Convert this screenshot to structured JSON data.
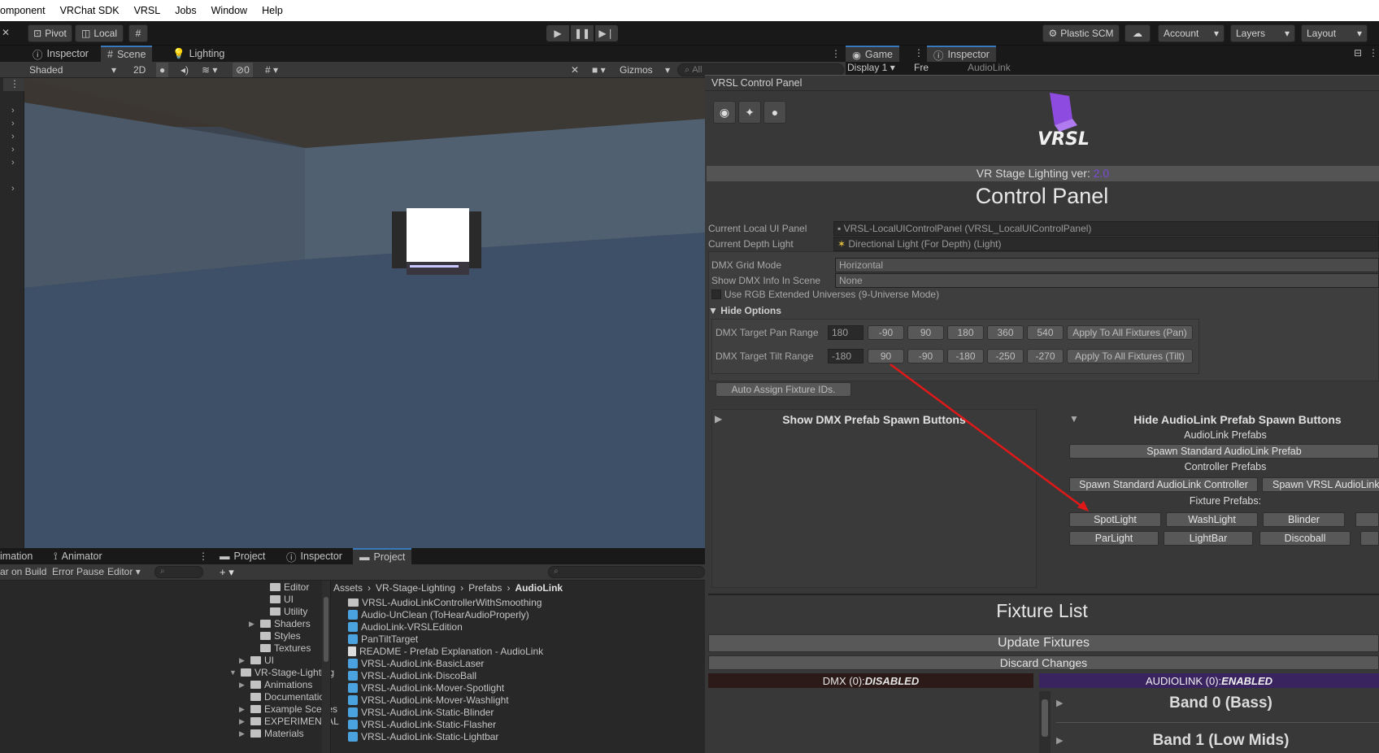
{
  "menubar": {
    "items": [
      "omponent",
      "VRChat SDK",
      "VRSL",
      "Jobs",
      "Window",
      "Help"
    ]
  },
  "toolbar": {
    "pivot": "Pivot",
    "local": "Local",
    "plastic": "Plastic SCM",
    "account": "Account",
    "layers": "Layers",
    "layout": "Layout"
  },
  "scene_tabs": {
    "inspector": "Inspector",
    "scene": "Scene",
    "lighting": "Lighting"
  },
  "scene_toolbar": {
    "shading": "Shaded",
    "mode2d": "2D",
    "hidden_count": "0",
    "gizmos": "Gizmos",
    "search_placeholder": "All"
  },
  "game_tabs": {
    "game": "Game",
    "display": "Display 1",
    "free": "Fre",
    "inspector": "Inspector",
    "obj": "AudioLink"
  },
  "vrsl": {
    "window_title": "VRSL Control Panel",
    "logo_text": "VRSL",
    "version_label": "VR Stage Lighting ver: ",
    "version": "2.0",
    "title": "Control Panel",
    "props": {
      "ui_panel_label": "Current Local UI Panel",
      "ui_panel_value": "VRSL-LocalUIControlPanel (VRSL_LocalUIControlPanel)",
      "depth_light_label": "Current Depth Light",
      "depth_light_value": "Directional Light (For Depth) (Light)",
      "grid_mode_label": "DMX Grid Mode",
      "grid_mode_value": "Horizontal",
      "show_info_label": "Show DMX Info In Scene",
      "show_info_value": "None",
      "rgb_extended_label": "Use RGB Extended Universes (9-Universe Mode)"
    },
    "hide_options": "Hide Options",
    "pan": {
      "label": "DMX Target Pan Range",
      "value": "180",
      "buttons": [
        "-90",
        "90",
        "180",
        "360",
        "540"
      ],
      "apply": "Apply To All Fixtures (Pan)"
    },
    "tilt": {
      "label": "DMX Target Tilt Range",
      "value": "-180",
      "buttons": [
        "90",
        "-90",
        "-180",
        "-250",
        "-270"
      ],
      "apply": "Apply To All Fixtures (Tilt)"
    },
    "auto_assign": "Auto Assign Fixture IDs.",
    "dmx_spawn": "Show DMX Prefab Spawn Buttons",
    "audiolink_spawn": "Hide AudioLink Prefab Spawn Buttons",
    "audiolink_prefabs": "AudioLink Prefabs",
    "spawn_standard": "Spawn Standard AudioLink Prefab",
    "controller_prefabs": "Controller Prefabs",
    "spawn_controller": "Spawn Standard AudioLink Controller",
    "spawn_vrsl": "Spawn VRSL AudioLink",
    "fixture_prefabs": "Fixture Prefabs:",
    "fixtures_row1": [
      "SpotLight",
      "WashLight",
      "Blinder"
    ],
    "fixtures_row2": [
      "ParLight",
      "LightBar",
      "Discoball"
    ],
    "fixture_list": "Fixture List",
    "update": "Update Fixtures",
    "discard": "Discard Changes",
    "dmx_status_label": "DMX (0): ",
    "dmx_status": "DISABLED",
    "audiolink_status_label": "AUDIOLINK (0): ",
    "audiolink_status": "ENABLED",
    "bands": [
      "Band 0 (Bass)",
      "Band 1 (Low Mids)"
    ]
  },
  "animator": {
    "tab1": "imation",
    "tab2": "Animator",
    "clear_on_build": "ar on Build",
    "error_pause": "Error Pause",
    "editor": "Editor"
  },
  "project": {
    "tabs": [
      "Project",
      "Inspector",
      "Project"
    ],
    "breadcrumb": [
      "Assets",
      "VR-Stage-Lighting",
      "Prefabs",
      "AudioLink"
    ],
    "tree": [
      {
        "label": "Editor",
        "depth": 3,
        "arrow": false
      },
      {
        "label": "UI",
        "depth": 3,
        "arrow": false
      },
      {
        "label": "Utility",
        "depth": 3,
        "arrow": false
      },
      {
        "label": "Shaders",
        "depth": 2,
        "arrow": true
      },
      {
        "label": "Styles",
        "depth": 2,
        "arrow": false
      },
      {
        "label": "Textures",
        "depth": 2,
        "arrow": false
      },
      {
        "label": "UI",
        "depth": 1,
        "arrow": true
      },
      {
        "label": "VR-Stage-Lighting",
        "depth": 0,
        "arrow": true,
        "open": true
      },
      {
        "label": "Animations",
        "depth": 1,
        "arrow": true
      },
      {
        "label": "Documentation",
        "depth": 1,
        "arrow": false
      },
      {
        "label": "Example Scenes",
        "depth": 1,
        "arrow": true
      },
      {
        "label": "EXPERIMENTAL",
        "depth": 1,
        "arrow": true
      },
      {
        "label": "Materials",
        "depth": 1,
        "arrow": true
      }
    ],
    "files": [
      {
        "label": "VRSL-AudioLinkControllerWithSmoothing",
        "kind": "folder"
      },
      {
        "label": "Audio-UnClean (ToHearAudioProperly)",
        "kind": "prefab"
      },
      {
        "label": "AudioLink-VRSLEdition",
        "kind": "prefab"
      },
      {
        "label": "PanTiltTarget",
        "kind": "prefab"
      },
      {
        "label": "README - Prefab Explanation - AudioLink",
        "kind": "doc"
      },
      {
        "label": "VRSL-AudioLink-BasicLaser",
        "kind": "prefab"
      },
      {
        "label": "VRSL-AudioLink-DiscoBall",
        "kind": "prefab"
      },
      {
        "label": "VRSL-AudioLink-Mover-Spotlight",
        "kind": "prefab"
      },
      {
        "label": "VRSL-AudioLink-Mover-Washlight",
        "kind": "prefab"
      },
      {
        "label": "VRSL-AudioLink-Static-Blinder",
        "kind": "prefab"
      },
      {
        "label": "VRSL-AudioLink-Static-Flasher",
        "kind": "prefab"
      },
      {
        "label": "VRSL-AudioLink-Static-Lightbar",
        "kind": "prefab"
      }
    ]
  },
  "colors": {
    "accent": "#3a79bb",
    "version": "#7a4bd6",
    "dmx_bg": "#2b1a18",
    "audiolink_bg": "#3a2460",
    "arrow": "#e01818"
  }
}
